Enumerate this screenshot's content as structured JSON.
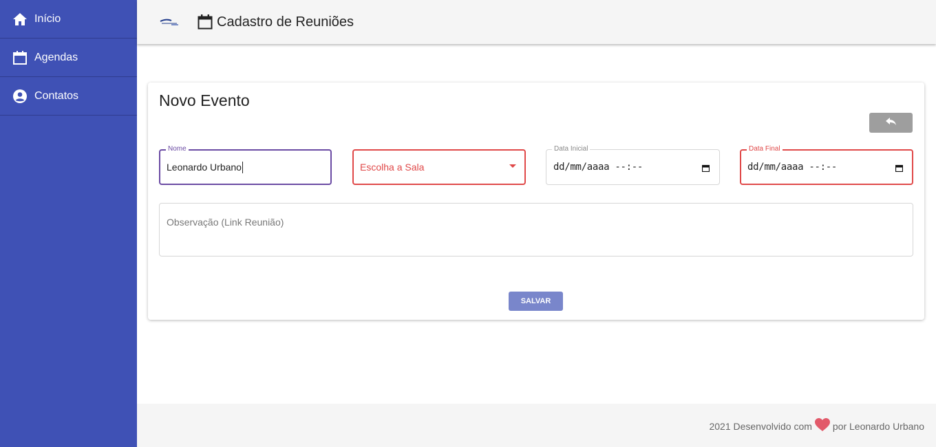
{
  "sidebar": {
    "items": [
      {
        "label": "Início",
        "icon": "home-icon"
      },
      {
        "label": "Agendas",
        "icon": "calendar-icon"
      },
      {
        "label": "Contatos",
        "icon": "account-circle-icon"
      }
    ]
  },
  "header": {
    "title": "Cadastro de Reuniões",
    "logo": "app-logo"
  },
  "form": {
    "title": "Novo Evento",
    "back_button_icon": "reply-icon",
    "fields": {
      "nome": {
        "label": "Nome",
        "value": "Leonardo Urbano"
      },
      "sala": {
        "placeholder": "Escolha a Sala"
      },
      "data_inicial": {
        "label": "Data Inicial",
        "value": "dd/mm/aaaa --:--"
      },
      "data_final": {
        "label": "Data Final",
        "value": "dd/mm/aaaa --:--"
      },
      "observacao": {
        "placeholder": "Observação (Link Reunião)"
      }
    },
    "save_label": "SALVAR"
  },
  "footer": {
    "text_before": "2021 Desenvolvido com",
    "text_after": "por Leonardo Urbano",
    "heart_icon": "heart-icon"
  },
  "colors": {
    "sidebar": "#3f51b5",
    "focus": "#6a4aa3",
    "error": "#e04848",
    "save_button": "#7986cb",
    "back_button": "#9e9e9e",
    "heart": "#e25a6a"
  }
}
